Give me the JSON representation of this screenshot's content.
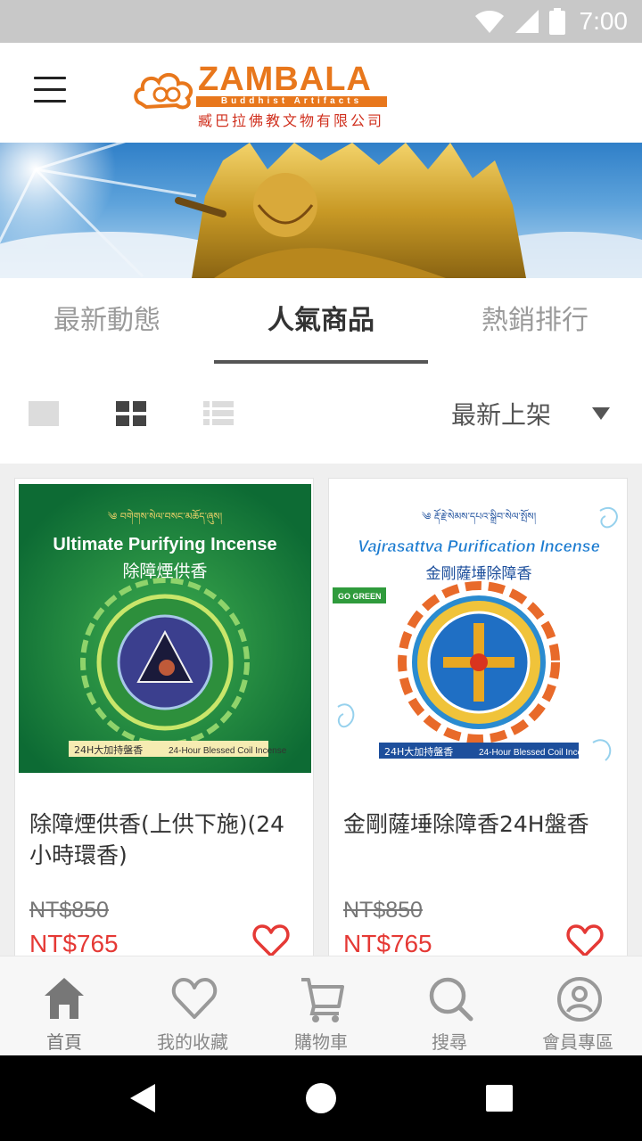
{
  "status_bar": {
    "time": "7:00"
  },
  "header": {
    "brand": "ZAMBALA",
    "brand_sub": "Buddhist Artifacts",
    "brand_cn": "臧巴拉佛教文物有限公司"
  },
  "tabs": [
    {
      "label": "最新動態",
      "active": false
    },
    {
      "label": "人氣商品",
      "active": true
    },
    {
      "label": "熱銷排行",
      "active": false
    }
  ],
  "toolbar": {
    "views": [
      "single-view-icon",
      "grid-view-icon",
      "list-view-icon"
    ],
    "sort_label": "最新上架"
  },
  "products": [
    {
      "name": "除障煙供香(上供下施)(24小時環香)",
      "original_price": "NT$850",
      "price": "NT$765",
      "image": {
        "top_script": "༄ བགེགས་སེལ་བསང་མཆོད་ཞུས།",
        "title_en": "Ultimate Purifying Incense",
        "title_cn": "除障煙供香",
        "badge_cn": "24H大加持盤香",
        "badge_en": "24-Hour Blessed Coil Incense"
      }
    },
    {
      "name": "金剛薩埵除障香24H盤香",
      "original_price": "NT$850",
      "price": "NT$765",
      "image": {
        "top_script": "༄ རྡོ་རྗེ་སེམས་དཔའ་སྒྲིབ་སེལ་སྤོས།",
        "title_en": "Vajrasattva Purification Incense",
        "title_cn": "金剛薩埵除障香",
        "side_tag": "GO GREEN",
        "badge_cn": "24H大加持盤香",
        "badge_en": "24-Hour Blessed Coil Incense"
      }
    }
  ],
  "bottom_nav": [
    {
      "icon": "home-icon",
      "label": "首頁"
    },
    {
      "icon": "heart-icon",
      "label": "我的收藏"
    },
    {
      "icon": "cart-icon",
      "label": "購物車"
    },
    {
      "icon": "search-icon",
      "label": "搜尋"
    },
    {
      "icon": "account-icon",
      "label": "會員專區"
    }
  ],
  "colors": {
    "brand_orange": "#e8771c",
    "price_red": "#e53935",
    "active_tab": "#333333",
    "inactive_tab": "#9a9a9a"
  }
}
